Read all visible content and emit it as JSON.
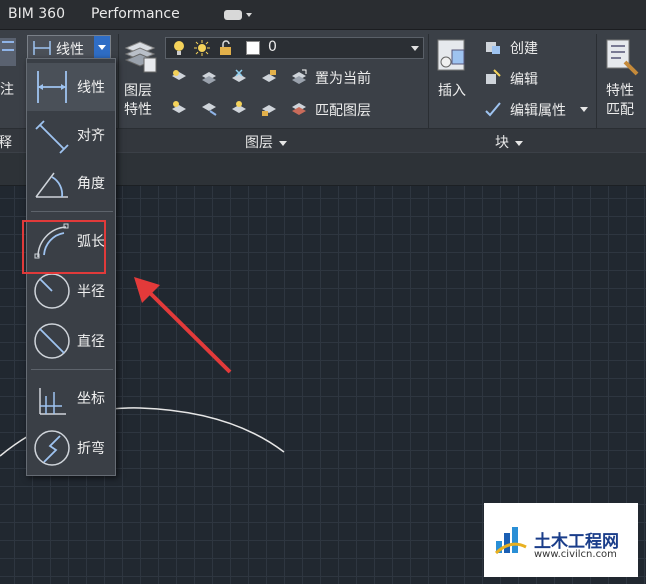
{
  "tabs": [
    "BIM 360",
    "Performance"
  ],
  "ribbon": {
    "left_partial_top": "注",
    "left_partial_bottom": "释",
    "dim_current": "线性",
    "layer_props_label_1": "图层",
    "layer_props_label_2": "特性",
    "layer_current": "0",
    "set_current": "置为当前",
    "match_layer": "匹配图层",
    "insert": "插入",
    "create": "创建",
    "edit": "编辑",
    "edit_attr": "编辑属性",
    "match_props_1": "特性",
    "match_props_2": "匹配",
    "panel_layers": "图层",
    "panel_block": "块",
    "panel_annotation_partial": "注释"
  },
  "dim_menu": [
    {
      "label": "线性",
      "icon": "dim-linear-icon"
    },
    {
      "label": "对齐",
      "icon": "dim-aligned-icon"
    },
    {
      "label": "角度",
      "icon": "dim-angular-icon"
    },
    {
      "label": "弧长",
      "icon": "dim-arc-length-icon"
    },
    {
      "label": "半径",
      "icon": "dim-radius-icon"
    },
    {
      "label": "直径",
      "icon": "dim-diameter-icon"
    },
    {
      "label": "坐标",
      "icon": "dim-ordinate-icon"
    },
    {
      "label": "折弯",
      "icon": "dim-jogged-icon"
    }
  ],
  "colors": {
    "highlight": "#e03a3a",
    "accent": "#2f6dc5",
    "arc": "#e6e6e6"
  },
  "watermark": {
    "title": "土木工程网",
    "url": "www.civilcn.com"
  }
}
